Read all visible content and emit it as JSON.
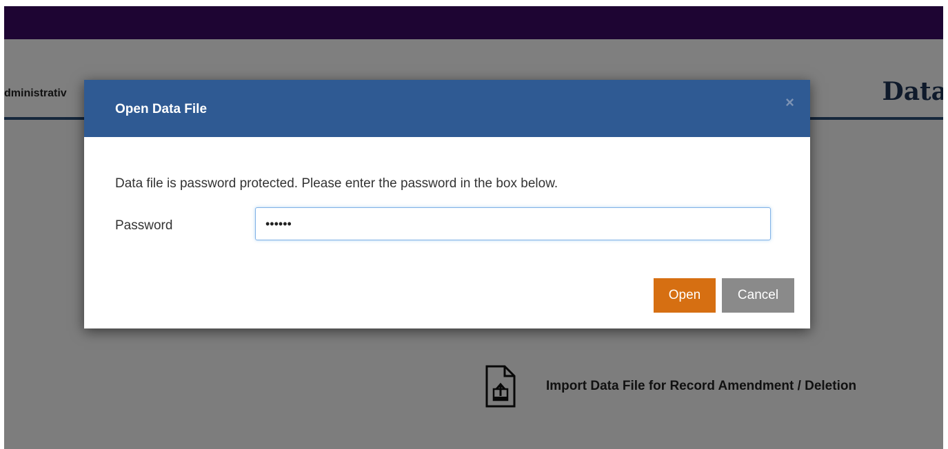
{
  "background": {
    "admin_text": "dministrativ",
    "page_heading": "Data",
    "import_link": {
      "label": "Import Data File for Record Amendment / Deletion",
      "icon": "file-upload-icon"
    }
  },
  "modal": {
    "title": "Open Data File",
    "close_label": "×",
    "message": "Data file is password protected. Please enter the password in the box below.",
    "password_label": "Password",
    "password_value": "123456",
    "open_label": "Open",
    "cancel_label": "Cancel"
  },
  "colors": {
    "topbar": "#3d0a66",
    "modal_header": "#2f5a93",
    "open_button": "#d66f12",
    "cancel_button": "#8a8a8a",
    "heading": "#1f3556"
  }
}
